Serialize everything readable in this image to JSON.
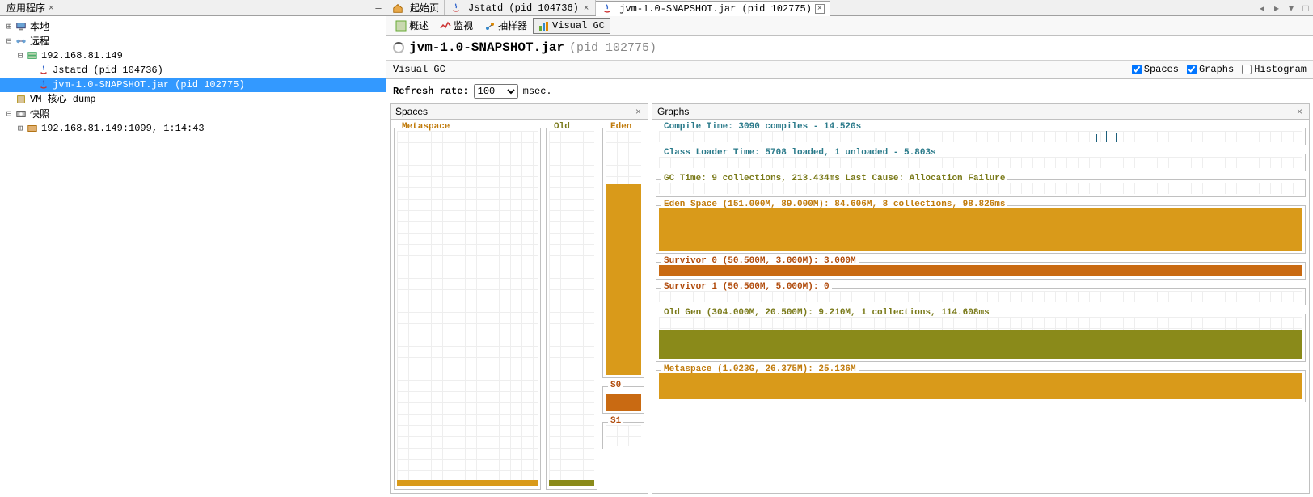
{
  "left": {
    "tab_title": "应用程序",
    "tree": {
      "local": "本地",
      "remote": "远程",
      "host": "192.168.81.149",
      "jstatd": "Jstatd (pid 104736)",
      "jvm": "jvm-1.0-SNAPSHOT.jar (pid 102775)",
      "vm_core": "VM 核心 dump",
      "snapshot": "快照",
      "snap1": "192.168.81.149:1099, 1:14:43"
    }
  },
  "doc_tabs": {
    "start": "起始页",
    "jstatd": "Jstatd (pid 104736)",
    "jvm": "jvm-1.0-SNAPSHOT.jar (pid 102775)"
  },
  "sub_tabs": {
    "overview": "概述",
    "monitor": "监视",
    "sampler": "抽样器",
    "visualgc": "Visual GC"
  },
  "title": {
    "strong": "jvm-1.0-SNAPSHOT.jar",
    "dim": "(pid 102775)"
  },
  "subbar": {
    "label": "Visual GC"
  },
  "checks": {
    "spaces": "Spaces",
    "graphs": "Graphs",
    "histogram": "Histogram"
  },
  "refresh": {
    "label": "Refresh rate:",
    "value": "100",
    "unit": "msec."
  },
  "panes": {
    "spaces": "Spaces",
    "graphs": "Graphs"
  },
  "spaces": {
    "meta": "Metaspace",
    "old": "Old",
    "eden": "Eden",
    "s0": "S0",
    "s1": "S1"
  },
  "graphs": {
    "compile": "Compile Time: 3090 compiles - 14.520s",
    "classloader": "Class Loader Time: 5708 loaded, 1 unloaded - 5.803s",
    "gctime": "GC Time: 9 collections, 213.434ms Last Cause: Allocation Failure",
    "eden": "Eden Space (151.000M, 89.000M): 84.606M, 8 collections, 98.826ms",
    "s0": "Survivor 0 (50.500M, 3.000M): 3.000M",
    "s1": "Survivor 1 (50.500M, 5.000M): 0",
    "old": "Old Gen (304.000M, 20.500M): 9.210M, 1 collections, 114.608ms",
    "meta": "Metaspace (1.023G, 26.375M): 25.136M"
  },
  "chart_data": {
    "refresh_ms": 100,
    "compile": {
      "compiles": 3090,
      "time_s": 14.52
    },
    "class_loader": {
      "loaded": 5708,
      "unloaded": 1,
      "time_s": 5.803
    },
    "gc": {
      "collections": 9,
      "time_ms": 213.434,
      "last_cause": "Allocation Failure"
    },
    "eden": {
      "max_m": 151.0,
      "capacity_m": 89.0,
      "used_m": 84.606,
      "collections": 8,
      "time_ms": 98.826
    },
    "s0": {
      "max_m": 50.5,
      "capacity_m": 3.0,
      "used_m": 3.0
    },
    "s1": {
      "max_m": 50.5,
      "capacity_m": 5.0,
      "used_m": 0
    },
    "old": {
      "max_m": 304.0,
      "capacity_m": 20.5,
      "used_m": 9.21,
      "collections": 1,
      "time_ms": 114.608
    },
    "metaspace": {
      "max_g": 1.023,
      "capacity_m": 26.375,
      "used_m": 25.136
    }
  }
}
